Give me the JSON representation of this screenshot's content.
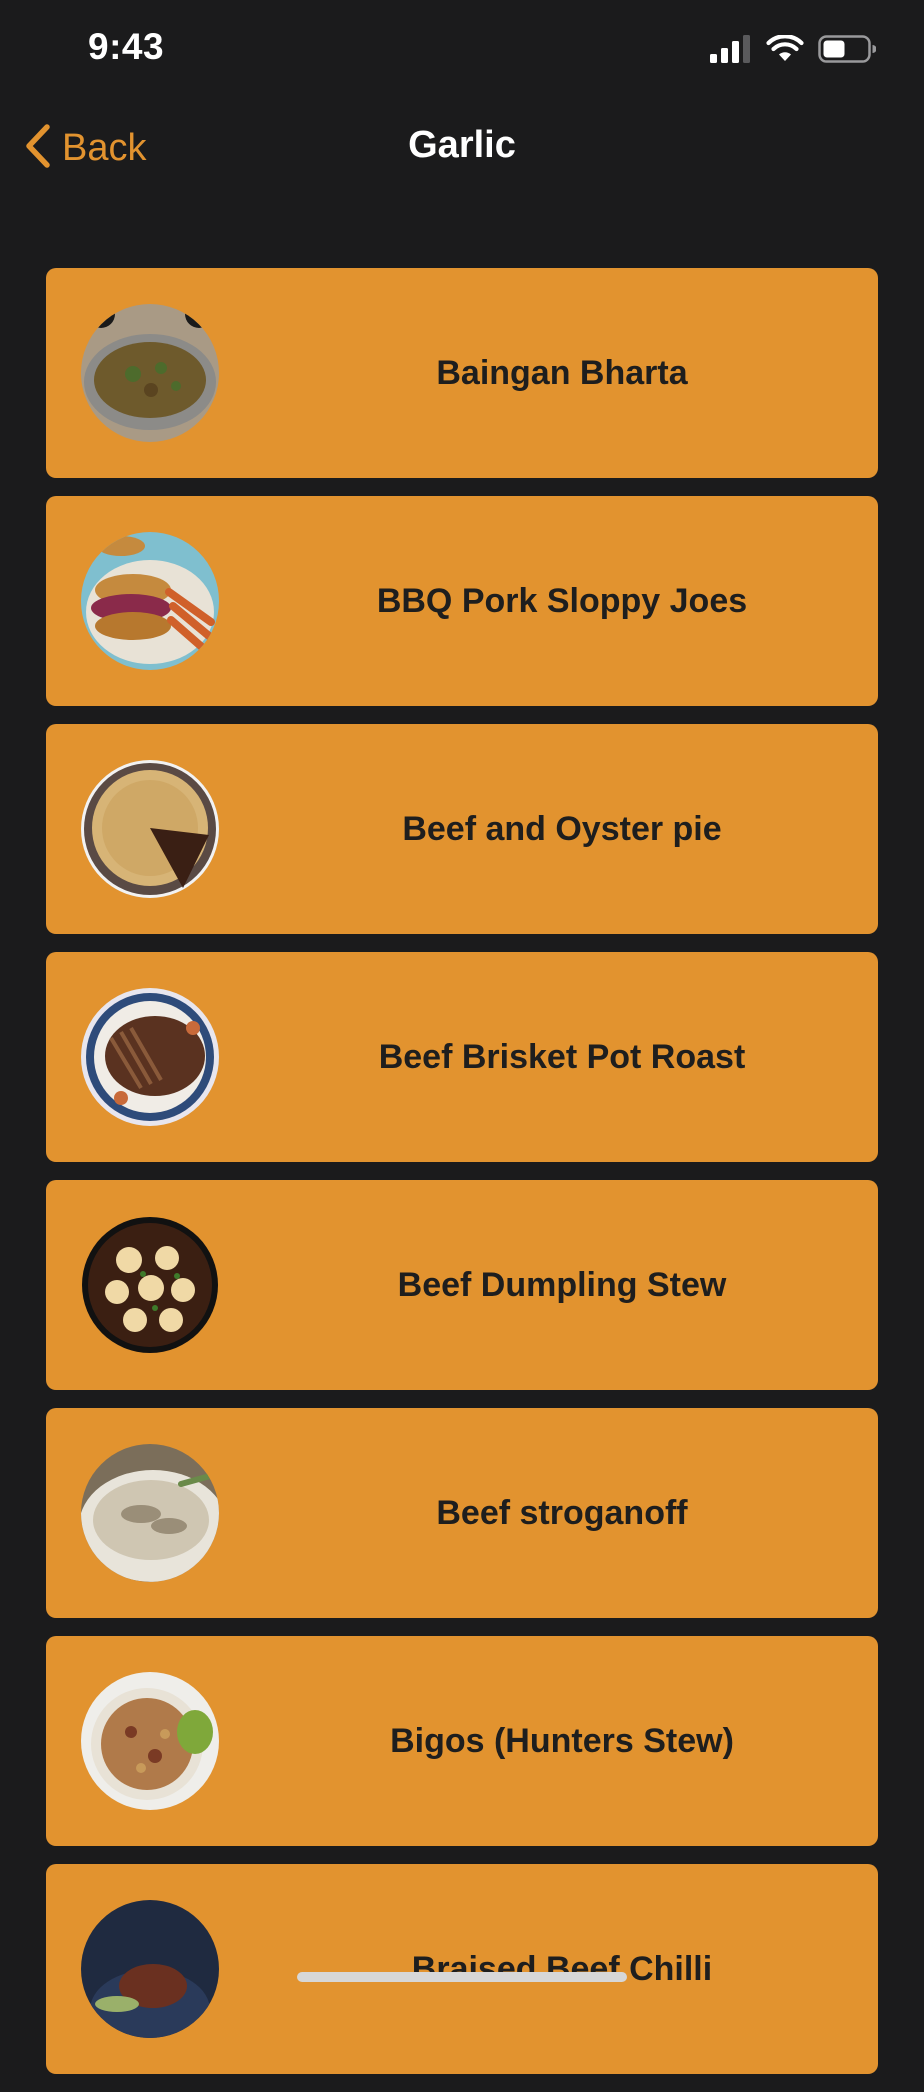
{
  "status_bar": {
    "time": "9:43",
    "signal_icon": "cellular-signal-icon",
    "wifi_icon": "wifi-icon",
    "battery_icon": "battery-icon",
    "battery_level": 0.45
  },
  "nav": {
    "back_label": "Back",
    "title": "Garlic",
    "accent_color": "#e2932f"
  },
  "recipes": [
    {
      "name": "Baingan Bharta",
      "thumb_colors": [
        "#6e5a2c",
        "#4d6b2c",
        "#a99a85"
      ]
    },
    {
      "name": "BBQ Pork Sloppy Joes",
      "thumb_colors": [
        "#c58a3e",
        "#8a2a4a",
        "#7fbfcf"
      ]
    },
    {
      "name": "Beef and Oyster pie",
      "thumb_colors": [
        "#d7b476",
        "#3a1f14",
        "#f2f2f2"
      ]
    },
    {
      "name": "Beef Brisket Pot Roast",
      "thumb_colors": [
        "#5a3220",
        "#2e4b7a",
        "#c86a3a"
      ]
    },
    {
      "name": "Beef Dumpling Stew",
      "thumb_colors": [
        "#3b1f12",
        "#f0d9a6",
        "#6a2a14"
      ]
    },
    {
      "name": "Beef stroganoff",
      "thumb_colors": [
        "#cfc6b2",
        "#7b6e5a",
        "#e8e4da"
      ]
    },
    {
      "name": "Bigos (Hunters Stew)",
      "thumb_colors": [
        "#b07a4a",
        "#e8e2d6",
        "#7fa83a"
      ]
    },
    {
      "name": "Braised Beef Chilli",
      "thumb_colors": [
        "#2a3a5a",
        "#6a3020",
        "#9ab06a"
      ]
    }
  ],
  "colors": {
    "background": "#1b1b1c",
    "card": "#e2932f",
    "card_text": "#1e1e1e"
  }
}
